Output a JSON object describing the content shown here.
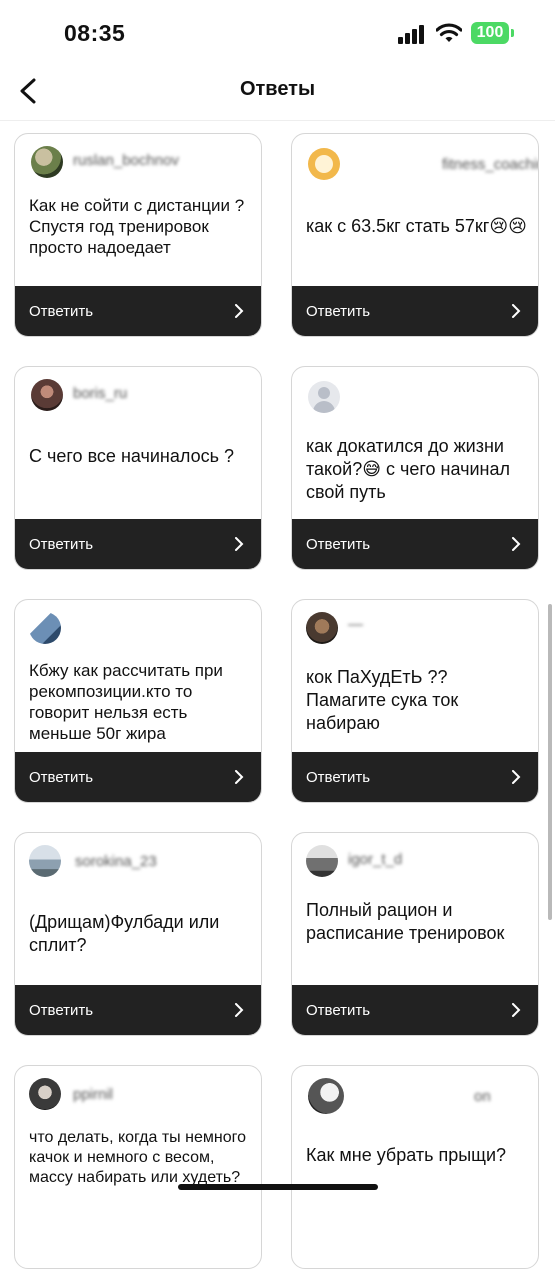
{
  "status": {
    "time": "08:35",
    "battery": "100"
  },
  "header": {
    "title": "Ответы"
  },
  "reply_label": "Ответить",
  "cards": [
    {
      "username": "ruslan_bochnov",
      "text": "Как не сойти с дистанции ?\nСпустя год тренировок просто надоедает",
      "avatar_color": "#6b7f4a"
    },
    {
      "username": "fitness_coaching",
      "text": "как с 63.5кг стать 57кг😢😢",
      "avatar_color": "#f2b84b"
    },
    {
      "username": "boris_ru",
      "text": "С чего все начиналось ?",
      "avatar_color": "#5a3b36"
    },
    {
      "username": "",
      "text": "как докатился до жизни такой?😅 с чего начинал свой путь",
      "avatar_color": "#b9bec8"
    },
    {
      "username": "",
      "text": "Кбжу как рассчитать при рекомпозиции.кто то говорит нельзя есть меньше 50г жира",
      "avatar_color": "#6c8fb5"
    },
    {
      "username": "—",
      "text": "кок ПаХудЕтЬ ??\nПамагите сука ток набираю",
      "avatar_color": "#4a3a30"
    },
    {
      "username": "sorokina_23",
      "text": "(Дрищам)Фулбади или сплит?",
      "avatar_color": "#8da0b0"
    },
    {
      "username": "igor_t_d",
      "text": "Полный рацион и расписание тренировок",
      "avatar_color": "#707070"
    },
    {
      "username": "ppirnil",
      "text": "что делать, когда ты немного качок и немного с весом, массу набирать или худеть?",
      "avatar_color": "#3a3a3a"
    },
    {
      "username": "on",
      "text": "Как мне убрать прыщи?",
      "avatar_color": "#555555"
    }
  ]
}
